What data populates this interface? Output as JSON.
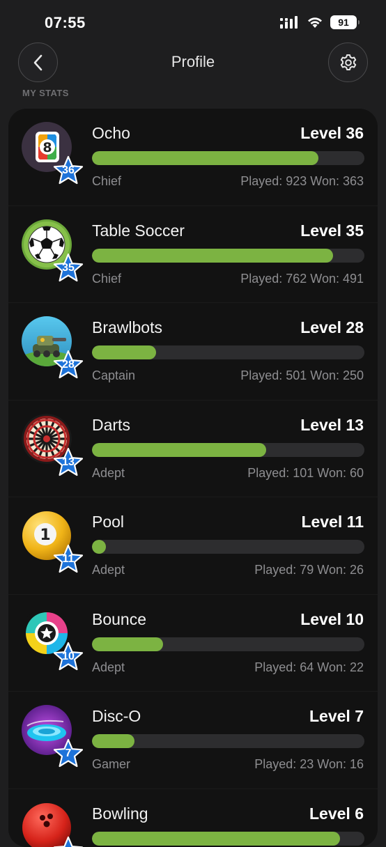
{
  "status": {
    "time": "07:55",
    "battery": "91"
  },
  "header": {
    "title": "Profile"
  },
  "section": {
    "label": "MY STATS"
  },
  "games": [
    {
      "name": "Ocho",
      "level_text": "Level 36",
      "badge": "36",
      "rank": "Chief",
      "stats": "Played: 923 Won: 363",
      "progress": 0.83,
      "icon": "ocho-icon"
    },
    {
      "name": "Table Soccer",
      "level_text": "Level 35",
      "badge": "35",
      "rank": "Chief",
      "stats": "Played: 762 Won: 491",
      "progress": 0.885,
      "icon": "soccer-ball-icon"
    },
    {
      "name": "Brawlbots",
      "level_text": "Level 28",
      "badge": "28",
      "rank": "Captain",
      "stats": "Played: 501 Won: 250",
      "progress": 0.235,
      "icon": "brawlbots-icon"
    },
    {
      "name": "Darts",
      "level_text": "Level 13",
      "badge": "13",
      "rank": "Adept",
      "stats": "Played: 101 Won: 60",
      "progress": 0.64,
      "icon": "dartboard-icon"
    },
    {
      "name": "Pool",
      "level_text": "Level 11",
      "badge": "11",
      "rank": "Adept",
      "stats": "Played: 79 Won: 26",
      "progress": 0.05,
      "icon": "pool-ball-icon"
    },
    {
      "name": "Bounce",
      "level_text": "Level 10",
      "badge": "10",
      "rank": "Adept",
      "stats": "Played: 64 Won: 22",
      "progress": 0.26,
      "icon": "bounce-icon"
    },
    {
      "name": "Disc-O",
      "level_text": "Level 7",
      "badge": "7",
      "rank": "Gamer",
      "stats": "Played: 23 Won: 16",
      "progress": 0.155,
      "icon": "disc-o-icon"
    },
    {
      "name": "Bowling",
      "level_text": "Level 6",
      "badge": "",
      "rank": "",
      "stats": "",
      "progress": 0.91,
      "icon": "bowling-ball-icon"
    }
  ],
  "colors": {
    "progress_fill": "#7cb342",
    "progress_track": "#2d2d2f",
    "star_badge": "#1e73d9",
    "background": "#1e1e1f",
    "card": "#121212"
  }
}
